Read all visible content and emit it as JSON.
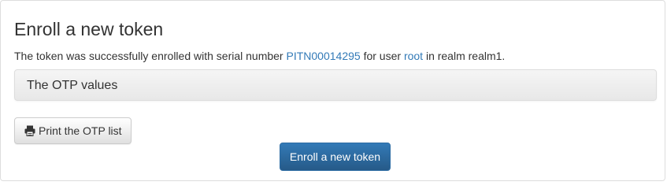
{
  "page": {
    "title": "Enroll a new token"
  },
  "message": {
    "prefix": "The token was successfully enrolled with serial number ",
    "serial": "PITN00014295",
    "middle": " for user ",
    "user": "root",
    "suffix": " in realm realm1."
  },
  "otp_panel": {
    "title": "The OTP values"
  },
  "buttons": {
    "print_label": "Print the OTP list",
    "print_icon": "print-icon",
    "enroll_label": "Enroll a new token"
  },
  "colors": {
    "link": "#337ab7",
    "primary": "#337ab7",
    "primary_dark": "#265a88"
  }
}
